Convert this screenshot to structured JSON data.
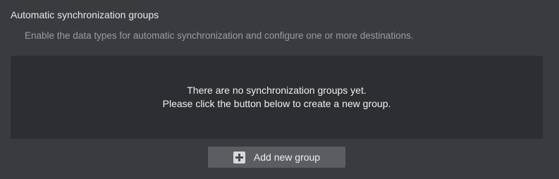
{
  "section": {
    "title": "Automatic synchronization groups",
    "description": "Enable the data types for automatic synchronization and configure one or more destinations."
  },
  "empty_state": {
    "line1": "There are no synchronization groups yet.",
    "line2": "Please click the button below to create a new group."
  },
  "add_button": {
    "icon": "plus-icon",
    "label": "Add new group"
  },
  "colors": {
    "background": "#3a3b3e",
    "empty_box": "#2c2e31",
    "button": "#5b5d61"
  }
}
